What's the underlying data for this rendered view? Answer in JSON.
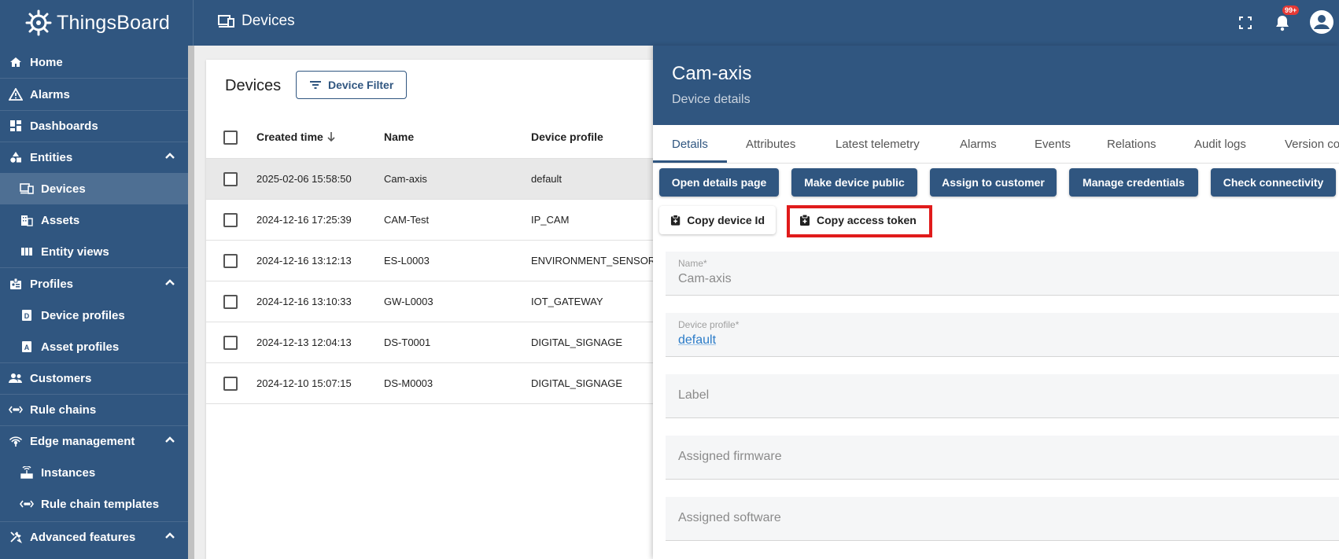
{
  "app": {
    "logo_text": "ThingsBoard",
    "page_title": "Devices",
    "notification_count": "99+"
  },
  "colors": {
    "primary": "#305680",
    "highlight": "#e01b1b",
    "link": "#2a7bc8"
  },
  "sidebar": {
    "items": [
      {
        "label": "Home",
        "icon": "home-icon"
      },
      {
        "label": "Alarms",
        "icon": "warning-icon"
      },
      {
        "label": "Dashboards",
        "icon": "dashboard-icon"
      },
      {
        "label": "Entities",
        "icon": "shapes-icon",
        "expanded": true
      },
      {
        "label": "Devices",
        "icon": "devices-icon",
        "active": true
      },
      {
        "label": "Assets",
        "icon": "building-icon"
      },
      {
        "label": "Entity views",
        "icon": "view-icon"
      },
      {
        "label": "Profiles",
        "icon": "badge-icon",
        "expanded": true
      },
      {
        "label": "Device profiles",
        "icon": "device-profile-icon"
      },
      {
        "label": "Asset profiles",
        "icon": "asset-profile-icon"
      },
      {
        "label": "Customers",
        "icon": "people-icon"
      },
      {
        "label": "Rule chains",
        "icon": "rule-chain-icon"
      },
      {
        "label": "Edge management",
        "icon": "antenna-icon",
        "expanded": true
      },
      {
        "label": "Instances",
        "icon": "router-icon"
      },
      {
        "label": "Rule chain templates",
        "icon": "rule-chain-icon"
      },
      {
        "label": "Advanced features",
        "icon": "tools-icon",
        "expanded": true
      }
    ]
  },
  "list": {
    "title": "Devices",
    "filter_label": "Device Filter",
    "columns": [
      "Created time",
      "Name",
      "Device profile"
    ],
    "rows": [
      {
        "created": "2025-02-06 15:58:50",
        "name": "Cam-axis",
        "profile": "default",
        "selected": true
      },
      {
        "created": "2024-12-16 17:25:39",
        "name": "CAM-Test",
        "profile": "IP_CAM"
      },
      {
        "created": "2024-12-16 13:12:13",
        "name": "ES-L0003",
        "profile": "ENVIRONMENT_SENSOR"
      },
      {
        "created": "2024-12-16 13:10:33",
        "name": "GW-L0003",
        "profile": "IOT_GATEWAY"
      },
      {
        "created": "2024-12-13 12:04:13",
        "name": "DS-T0001",
        "profile": "DIGITAL_SIGNAGE"
      },
      {
        "created": "2024-12-10 15:07:15",
        "name": "DS-M0003",
        "profile": "DIGITAL_SIGNAGE"
      }
    ]
  },
  "details": {
    "title": "Cam-axis",
    "subtitle": "Device details",
    "tabs": [
      "Details",
      "Attributes",
      "Latest telemetry",
      "Alarms",
      "Events",
      "Relations",
      "Audit logs",
      "Version co"
    ],
    "actions": [
      "Open details page",
      "Make device public",
      "Assign to customer",
      "Manage credentials",
      "Check connectivity"
    ],
    "copy_device_id": "Copy device Id",
    "copy_access_token": "Copy access token",
    "fields": {
      "name_label": "Name*",
      "name_value": "Cam-axis",
      "profile_label": "Device profile*",
      "profile_value": "default",
      "label_placeholder": "Label",
      "firmware_placeholder": "Assigned firmware",
      "software_placeholder": "Assigned software"
    }
  }
}
